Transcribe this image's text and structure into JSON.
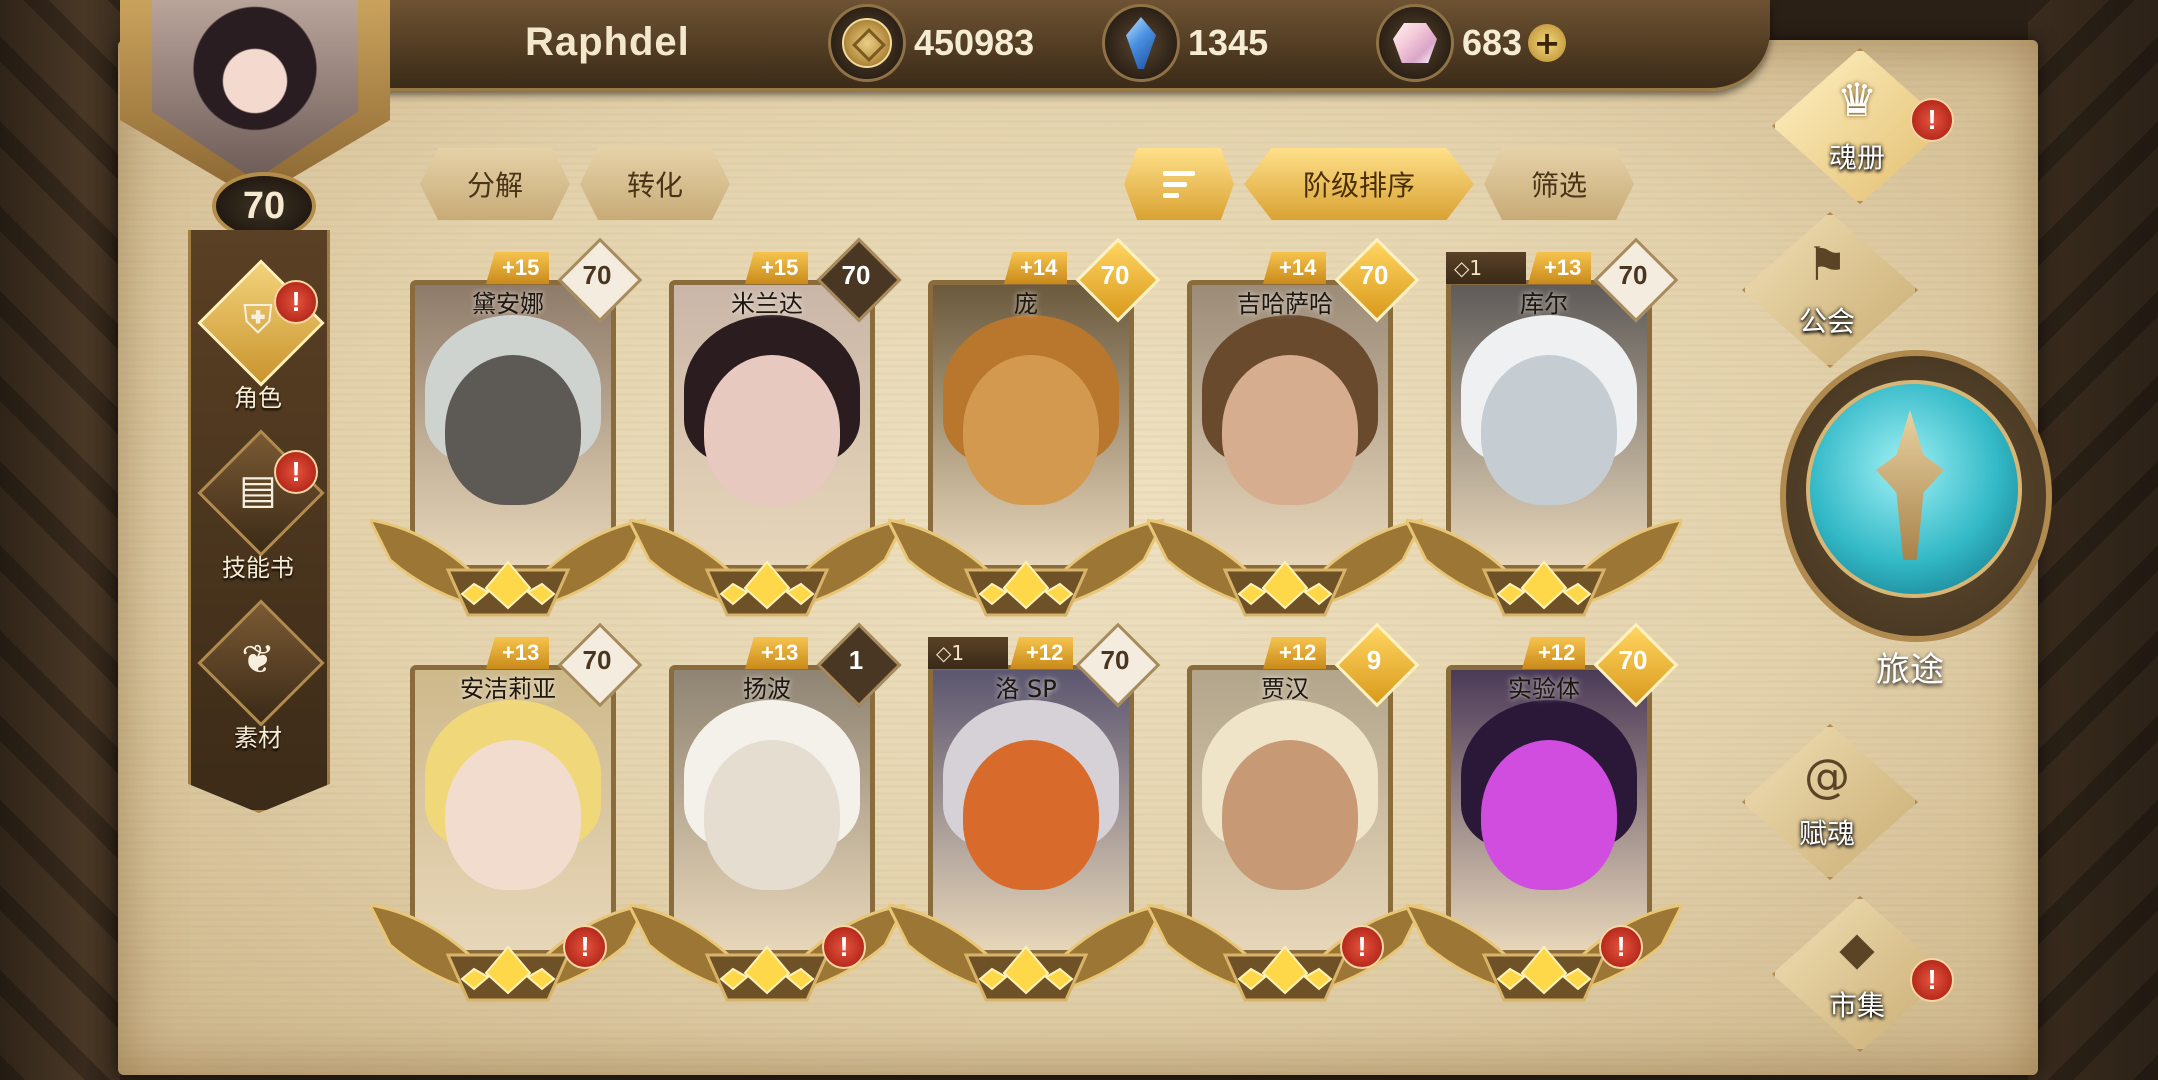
{
  "player": {
    "name": "Raphdel",
    "level": "70"
  },
  "resources": {
    "gold": "450983",
    "crystals": "1345",
    "gems": "683"
  },
  "toolbar": {
    "decompose": "分解",
    "convert": "转化",
    "sort_label": "阶级排序",
    "filter": "筛选"
  },
  "left_nav": [
    {
      "label": "角色",
      "icon": "helmet-icon",
      "alert": "!"
    },
    {
      "label": "技能书",
      "icon": "book-icon",
      "alert": "!"
    },
    {
      "label": "素材",
      "icon": "material-icon",
      "alert": ""
    }
  ],
  "right_nav": {
    "soul_book": "魂册",
    "guild": "公会",
    "journey": "旅途",
    "imbue": "赋魂",
    "market": "市集"
  },
  "cards": [
    {
      "name": "黛安娜",
      "plus": "+15",
      "level": "70",
      "stars": "",
      "alert": ""
    },
    {
      "name": "米兰达",
      "plus": "+15",
      "level": "70",
      "stars": "",
      "alert": ""
    },
    {
      "name": "庞",
      "plus": "+14",
      "level": "70",
      "stars": "",
      "alert": ""
    },
    {
      "name": "吉哈萨哈",
      "plus": "+14",
      "level": "70",
      "stars": "",
      "alert": ""
    },
    {
      "name": "库尔",
      "plus": "+13",
      "level": "70",
      "stars": "◇1",
      "alert": ""
    },
    {
      "name": "安洁莉亚",
      "plus": "+13",
      "level": "70",
      "stars": "",
      "alert": "!"
    },
    {
      "name": "扬波",
      "plus": "+13",
      "level": "1",
      "stars": "",
      "alert": "!"
    },
    {
      "name": "洛 SP",
      "plus": "+12",
      "level": "70",
      "stars": "◇1",
      "alert": ""
    },
    {
      "name": "贾汉",
      "plus": "+12",
      "level": "9",
      "stars": "",
      "alert": "!"
    },
    {
      "name": "实验体",
      "plus": "+12",
      "level": "70",
      "stars": "",
      "alert": "!"
    }
  ],
  "colors": {
    "accent_gold": "#f3c24a",
    "alert_red": "#c62b1a",
    "parchment": "#e8d9b8"
  }
}
